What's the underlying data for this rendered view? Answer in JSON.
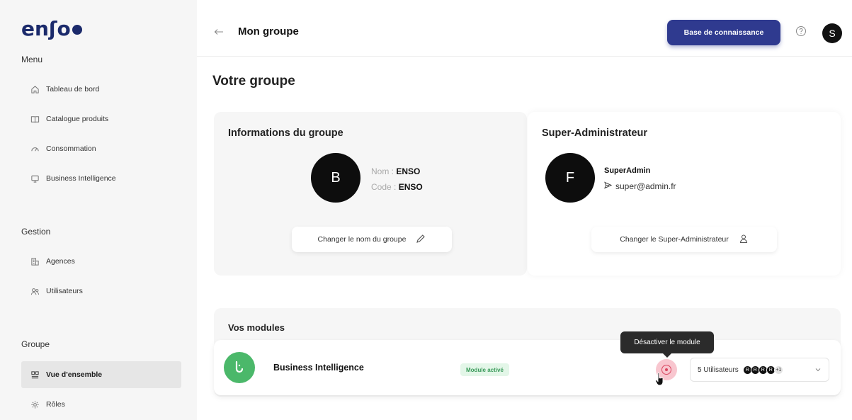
{
  "brand": {
    "logo_text": "enʃo"
  },
  "sidebar": {
    "sections": [
      {
        "label": "Menu",
        "items": [
          {
            "label": "Tableau de bord",
            "icon": "home-icon"
          },
          {
            "label": "Catalogue produits",
            "icon": "book-icon"
          },
          {
            "label": "Consommation",
            "icon": "gauge-icon"
          },
          {
            "label": "Business Intelligence",
            "icon": "monitor-icon"
          }
        ]
      },
      {
        "label": "Gestion",
        "items": [
          {
            "label": "Agences",
            "icon": "building-icon"
          },
          {
            "label": "Utilisateurs",
            "icon": "users-icon"
          }
        ]
      },
      {
        "label": "Groupe",
        "items": [
          {
            "label": "Vue d'ensemble",
            "icon": "overview-icon",
            "active": true
          },
          {
            "label": "Rôles",
            "icon": "gear-icon"
          }
        ]
      }
    ]
  },
  "header": {
    "title": "Mon groupe",
    "kb_button": "Base de connaissance",
    "user_initial": "S"
  },
  "main": {
    "title": "Votre groupe",
    "group_info": {
      "title": "Informations du groupe",
      "avatar_initial": "B",
      "name_label": "Nom :",
      "name_value": "ENSO",
      "code_label": "Code :",
      "code_value": "ENSO",
      "action_label": "Changer le nom du groupe"
    },
    "super_admin": {
      "title": "Super-Administrateur",
      "avatar_initial": "F",
      "name": "SuperAdmin",
      "email": "super@admin.fr",
      "action_label": "Changer le Super-Administrateur"
    },
    "modules": {
      "title": "Vos modules",
      "items": [
        {
          "icon_letter": "b",
          "name": "Business Intelligence",
          "status": "Module activé",
          "users_label": "5 Utilisateurs",
          "user_initials": [
            "R",
            "R",
            "R",
            "R"
          ],
          "more_count": "+1"
        }
      ],
      "tooltip": "Désactiver le module"
    }
  },
  "colors": {
    "primary": "#2f3a8f",
    "brand": "#1b2a6b",
    "module_green": "#4bb86a",
    "badge_bg": "#e3f6e8",
    "danger": "#d9455f",
    "sidebar_bg": "#f6f6f6"
  }
}
